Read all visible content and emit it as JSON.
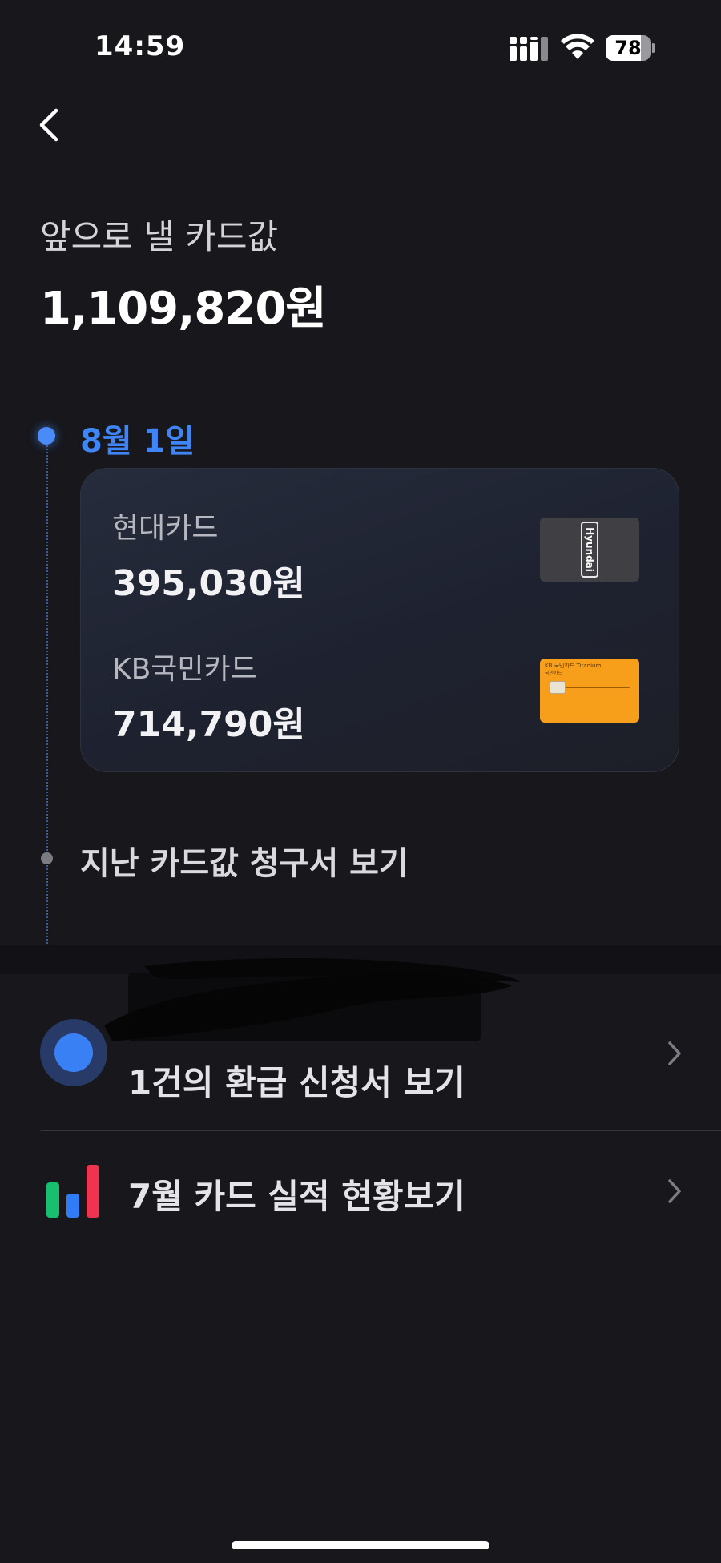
{
  "status_bar": {
    "time": "14:59",
    "battery": "78",
    "battery_level": 0.78
  },
  "header": {
    "label": "앞으로 낼 카드값",
    "amount": "1,109,820원"
  },
  "timeline": {
    "date": "8월 1일",
    "cards": [
      {
        "name": "현대카드",
        "amount": "395,030원",
        "thumb_text": "Hyundai"
      },
      {
        "name": "KB국민카드",
        "amount": "714,790원",
        "thumb_brand": "KB 국민카드 Titanium",
        "thumb_sub": "국민카드"
      }
    ],
    "past_bills": "지난 카드값 청구서 보기"
  },
  "refund": {
    "title": "1건의 환급 신청서 보기"
  },
  "stats": {
    "title": "7월 카드 실적 현황보기"
  },
  "colors": {
    "background": "#17171c",
    "accent_blue": "#3f85f6",
    "kb_orange": "#f79f1a",
    "chart_green": "#16c06e",
    "chart_blue": "#2f7cf6",
    "chart_red": "#f0334f"
  },
  "icons": {
    "back": "chevron-left-icon",
    "row_arrow": "chevron-right-icon",
    "refund": "circle-dot-icon",
    "stats": "bar-chart-icon"
  }
}
